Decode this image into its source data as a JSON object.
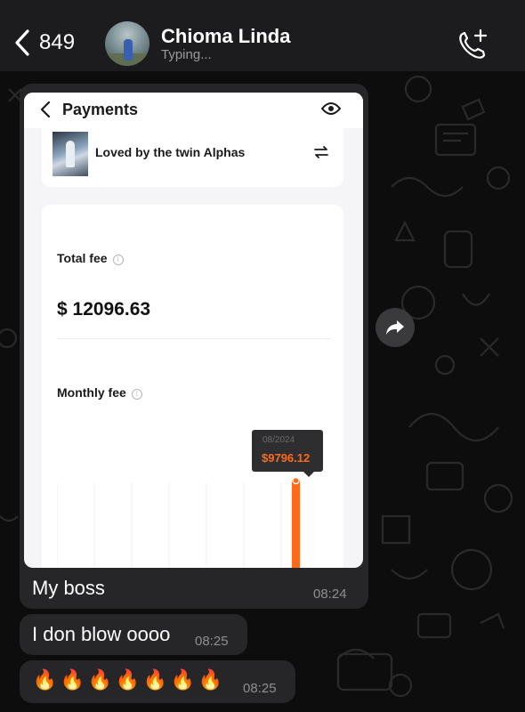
{
  "header": {
    "back_count": "849",
    "contact_name": "Chioma Linda",
    "status": "Typing..."
  },
  "screenshot": {
    "title": "Payments",
    "book_title": "Loved by the twin Alphas",
    "total_fee_label": "Total fee",
    "total_fee_value": "$ 12096.63",
    "monthly_fee_label": "Monthly fee",
    "info_glyph": "i",
    "tooltip_date": "08/2024",
    "tooltip_value": "$9796.12",
    "accent_color": "#ff6a1a"
  },
  "messages": [
    {
      "text": "My boss",
      "time": "08:24"
    },
    {
      "text": "I don blow oooo",
      "time": "08:25"
    },
    {
      "emoji": [
        "🔥",
        "🔥",
        "🔥",
        "🔥",
        "🔥",
        "🔥",
        "🔥"
      ],
      "time": "08:25"
    }
  ],
  "icons": {
    "back": "chevron-left-icon",
    "call": "add-call-icon",
    "forward": "forward-icon",
    "eye": "eye-icon",
    "swap": "swap-icon"
  }
}
